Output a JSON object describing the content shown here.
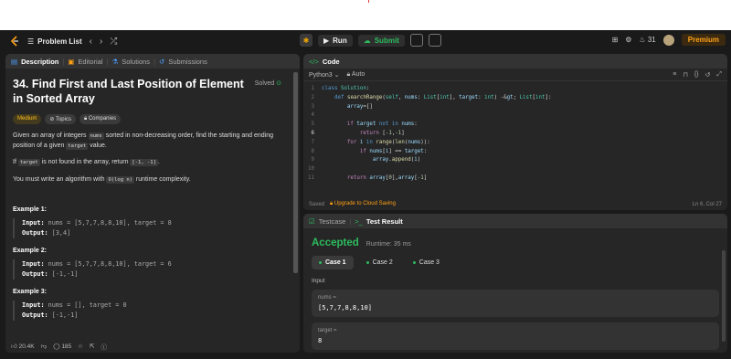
{
  "nav": {
    "problem_list": "Problem List",
    "run": "Run",
    "submit": "Submit",
    "streak": "31",
    "premium": "Premium"
  },
  "description_tabs": {
    "description": "Description",
    "editorial": "Editorial",
    "solutions": "Solutions",
    "submissions": "Submissions"
  },
  "problem": {
    "title": "34. Find First and Last Position of Element in Sorted Array",
    "solved": "Solved",
    "difficulty": "Medium",
    "topics": "Topics",
    "companies": "Companies",
    "p1_a": "Given an array of integers ",
    "p1_code1": "nums",
    "p1_b": " sorted in non-decreasing order, find the starting and ending position of a given ",
    "p1_code2": "target",
    "p1_c": " value.",
    "p2_a": "If ",
    "p2_code1": "target",
    "p2_b": " is not found in the array, return ",
    "p2_code2": "[-1, -1]",
    "p2_c": ".",
    "p3_a": "You must write an algorithm with ",
    "p3_code": "O(log n)",
    "p3_b": " runtime complexity.",
    "examples": [
      {
        "title": "Example 1:",
        "input_label": "Input:",
        "input": " nums = [5,7,7,8,8,10], target = 8",
        "output_label": "Output:",
        "output": " [3,4]"
      },
      {
        "title": "Example 2:",
        "input_label": "Input:",
        "input": " nums = [5,7,7,8,8,10], target = 6",
        "output_label": "Output:",
        "output": " [-1,-1]"
      },
      {
        "title": "Example 3:",
        "input_label": "Input:",
        "input": " nums = [], target = 0",
        "output_label": "Output:",
        "output": " [-1,-1]"
      }
    ]
  },
  "footer": {
    "likes": "20.4K",
    "comments": "185"
  },
  "code": {
    "tab": "Code",
    "language": "Python3",
    "auto": "Auto",
    "saved": "Saved",
    "upgrade": "Upgrade to Cloud Saving",
    "cursor": "Ln 6, Col 27",
    "lines": [
      "class Solution:",
      "    def searchRange(self, nums: List[int], target: int) -> List[int]:",
      "        array=[]",
      "",
      "        if target not in nums:",
      "            return [-1,-1]",
      "        for i in range(len(nums)):",
      "            if nums[i] == target:",
      "                array.append(i)",
      "",
      "        return array[0],array[-1]"
    ]
  },
  "result": {
    "testcase_tab": "Testcase",
    "result_tab": "Test Result",
    "status": "Accepted",
    "runtime": "Runtime: 35 ms",
    "cases": [
      "Case 1",
      "Case 2",
      "Case 3"
    ],
    "input_label": "Input",
    "inputs": [
      {
        "key": "nums =",
        "value": "[5,7,7,8,8,10]"
      },
      {
        "key": "target =",
        "value": "8"
      }
    ]
  },
  "colors": {
    "accent_orange": "#ffa116",
    "accepted_green": "#2cbb5d",
    "bg": "#1a1a1a",
    "panel": "#262626"
  }
}
